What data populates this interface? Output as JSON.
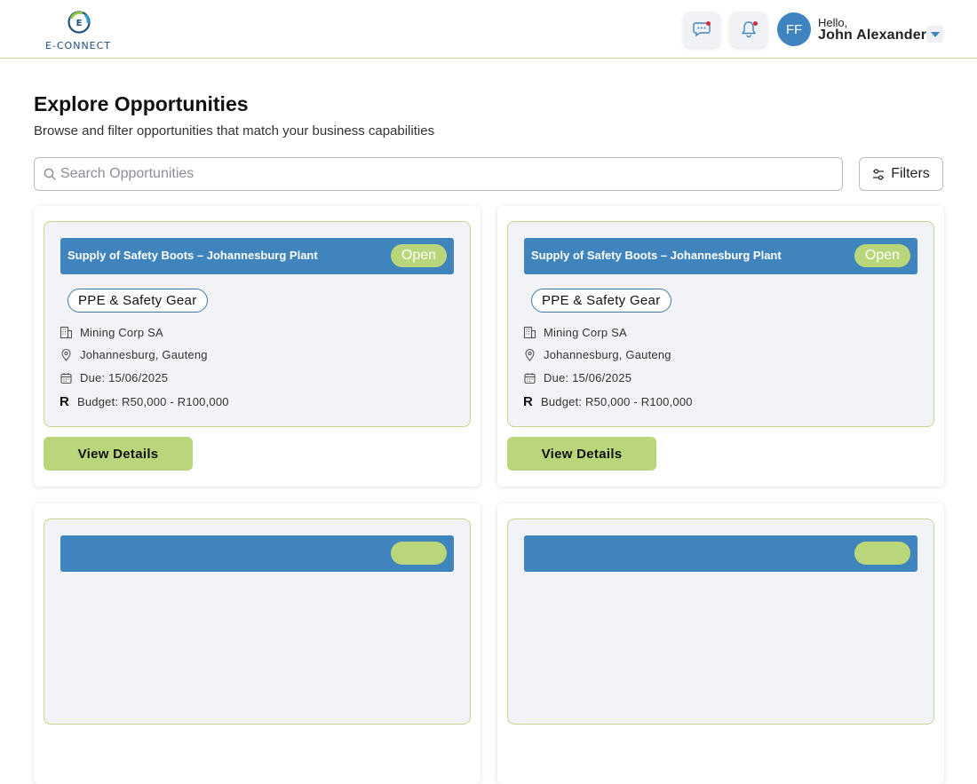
{
  "header": {
    "logo_text": "E-CONNECT",
    "greeting": "Hello,",
    "user_name": "John Alexander",
    "avatar_initials": "FF",
    "icons": [
      "chat-icon",
      "bell-icon",
      "chevron-down-icon"
    ]
  },
  "page": {
    "title": "Explore Opportunities",
    "subtitle": "Browse and filter opportunities that match your business capabilities"
  },
  "search": {
    "placeholder": "Search Opportunities"
  },
  "filters": {
    "label": "Filters"
  },
  "opportunities": [
    {
      "title": "Supply of Safety Boots – Johannesburg Plant",
      "status": "Open",
      "category": "PPE & Safety Gear",
      "company": "Mining Corp SA",
      "location": "Johannesburg, Gauteng",
      "due": "Due: 15/06/2025",
      "currency_symbol": "R",
      "budget": "Budget: R50,000 - R100,000",
      "action": "View Details"
    },
    {
      "title": "Supply of Safety Boots – Johannesburg Plant",
      "status": "Open",
      "category": "PPE & Safety Gear",
      "company": "Mining Corp SA",
      "location": "Johannesburg, Gauteng",
      "due": "Due: 15/06/2025",
      "currency_symbol": "R",
      "budget": "Budget: R50,000 - R100,000",
      "action": "View Details"
    }
  ],
  "colors": {
    "primary_blue": "#3f84bd",
    "accent_green": "#b9d67a",
    "card_border": "#c3d68e",
    "notification_dot": "#d6293a"
  }
}
